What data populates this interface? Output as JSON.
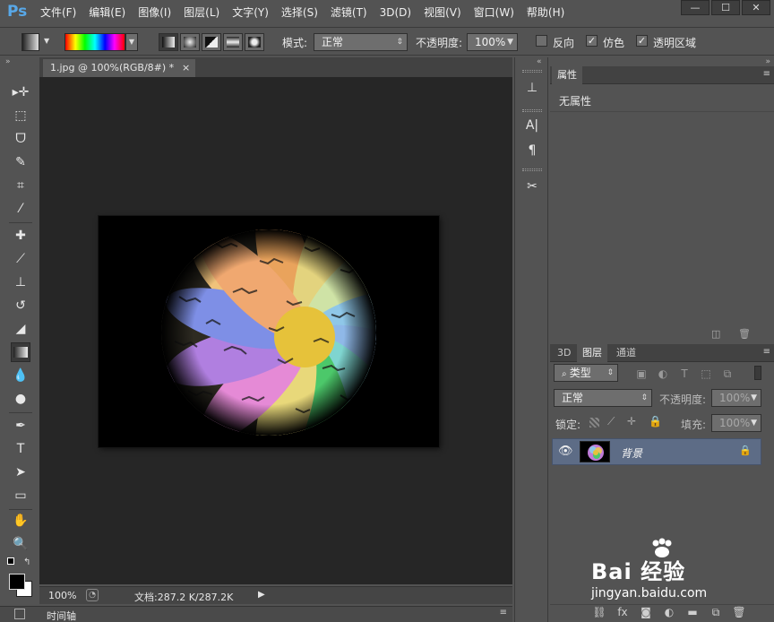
{
  "app": {
    "logo": "Ps"
  },
  "menu": [
    "文件(F)",
    "编辑(E)",
    "图像(I)",
    "图层(L)",
    "文字(Y)",
    "选择(S)",
    "滤镜(T)",
    "3D(D)",
    "视图(V)",
    "窗口(W)",
    "帮助(H)"
  ],
  "window_controls": {
    "minimize": "—",
    "restore": "☐",
    "close": "✕"
  },
  "options": {
    "mode_label": "模式:",
    "mode_value": "正常",
    "opacity_label": "不透明度:",
    "opacity_value": "100%",
    "reverse_label": "反向",
    "dither_label": "仿色",
    "transparency_label": "透明区域"
  },
  "document": {
    "tab_title": "1.jpg @ 100%(RGB/8#) *",
    "tab_close": "×",
    "zoom": "100%",
    "doc_info": "文档:287.2 K/287.2K"
  },
  "timeline": {
    "label": "时间轴"
  },
  "properties": {
    "tab": "属性",
    "content": "无属性"
  },
  "layers": {
    "tabs": [
      "3D",
      "图层",
      "通道"
    ],
    "active_tab": "图层",
    "filter_label": "类型",
    "blend_mode": "正常",
    "opacity_label": "不透明度:",
    "opacity_value": "100%",
    "lock_label": "锁定:",
    "fill_label": "填充:",
    "fill_value": "100%",
    "layer_name": "背景"
  },
  "watermark": {
    "brand": "Bai 经验",
    "url": "jingyan.baidu.com"
  },
  "colors": {
    "ui_bg": "#535353",
    "canvas_bg": "#262626",
    "selected_layer": "#5d6c86",
    "logo_blue": "#58a8e8"
  },
  "icons": {
    "tools": [
      "move-icon",
      "marquee-icon",
      "lasso-icon",
      "quick-select-icon",
      "crop-icon",
      "eyedropper-icon",
      "healing-icon",
      "brush-icon",
      "stamp-icon",
      "history-brush-icon",
      "eraser-icon",
      "gradient-icon",
      "blur-icon",
      "dodge-icon",
      "pen-icon",
      "type-icon",
      "path-select-icon",
      "shape-icon",
      "hand-icon",
      "zoom-icon"
    ]
  }
}
